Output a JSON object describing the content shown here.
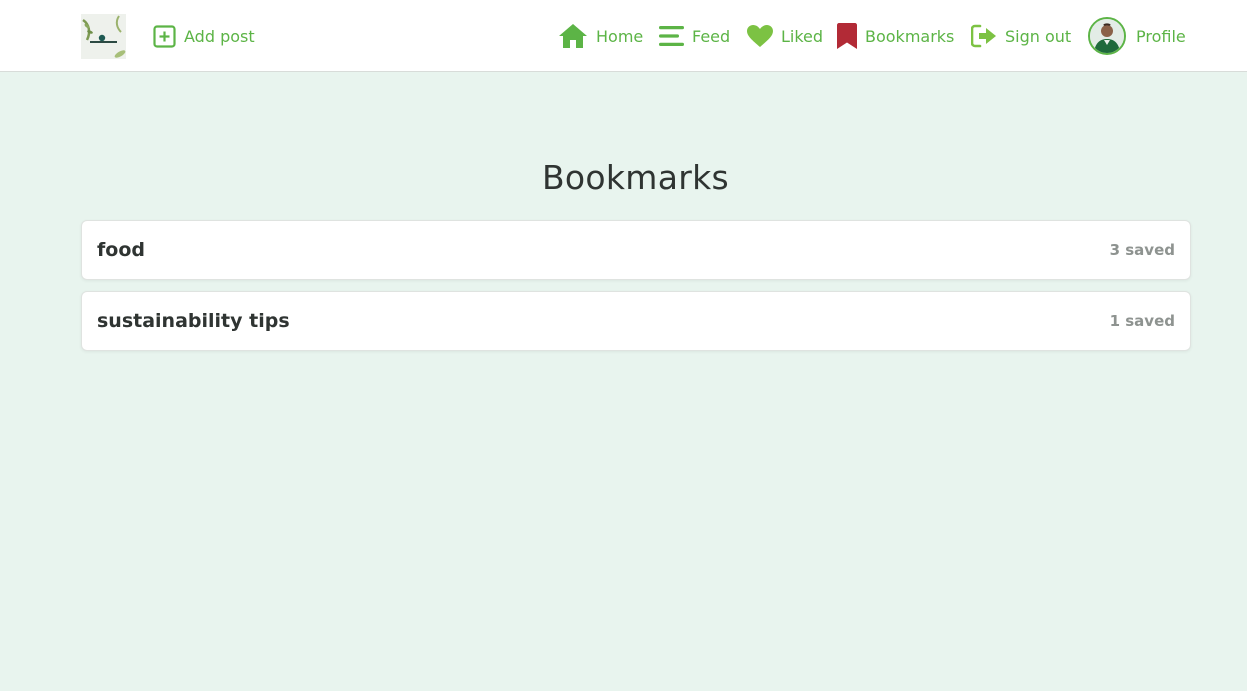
{
  "nav": {
    "add_post": "Add post",
    "home": "Home",
    "feed": "Feed",
    "liked": "Liked",
    "bookmarks": "Bookmarks",
    "sign_out": "Sign out",
    "profile": "Profile"
  },
  "page": {
    "title": "Bookmarks"
  },
  "folders": [
    {
      "name": "food",
      "count": "3 saved"
    },
    {
      "name": "sustainability tips",
      "count": "1 saved"
    }
  ],
  "colors": {
    "accent": "#5cb446",
    "bookmark_active": "#b22a36",
    "background": "#e8f4ee"
  },
  "icons": {
    "add_post": "plus-square-icon",
    "home": "house-icon",
    "feed": "bars-icon",
    "liked": "heart-icon",
    "bookmarks": "bookmark-icon",
    "sign_out": "sign-out-icon"
  }
}
